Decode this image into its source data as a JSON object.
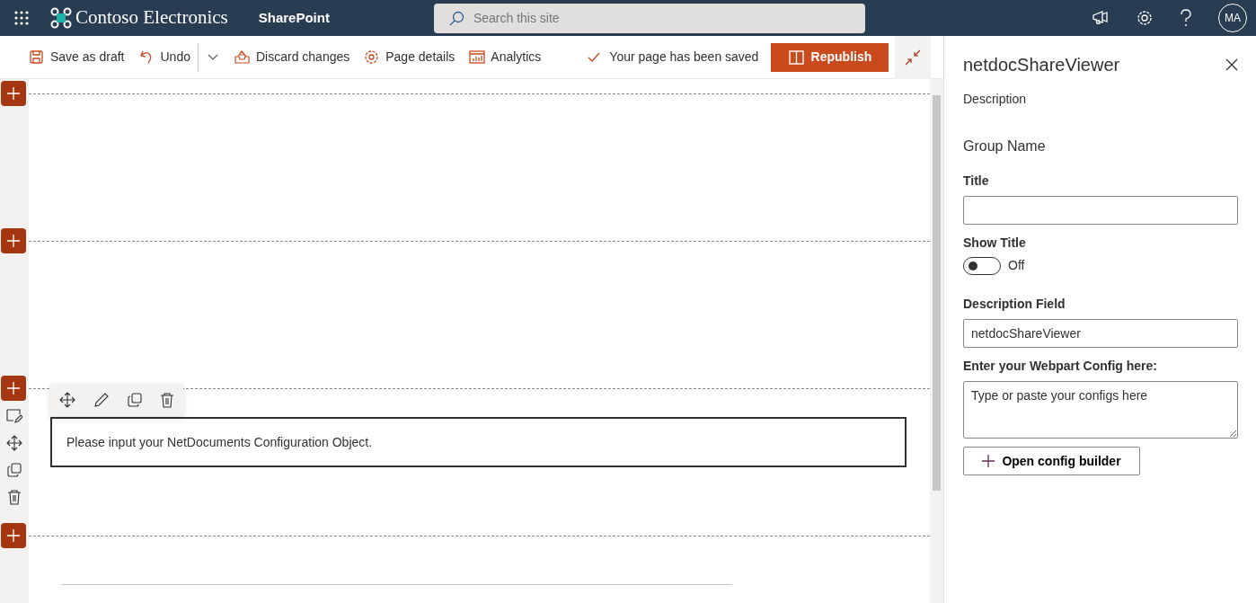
{
  "header": {
    "site_title": "Contoso Electronics",
    "app_name": "SharePoint",
    "search": {
      "placeholder": "Search this site"
    },
    "avatar": "MA"
  },
  "toolbar": {
    "items": [
      {
        "kind": "save",
        "label": "Save as draft"
      },
      {
        "kind": "undo",
        "label": "Undo"
      },
      {
        "kind": "dropdown"
      },
      {
        "kind": "discard",
        "label": "Discard changes"
      },
      {
        "kind": "details",
        "label": "Page details"
      },
      {
        "kind": "analytics",
        "label": "Analytics"
      }
    ],
    "status": "Your page has been saved",
    "publish": "Republish"
  },
  "canvas": {
    "sections": [
      {
        "kind": "empty"
      },
      {
        "kind": "empty"
      },
      {
        "kind": "webpart",
        "selected": true,
        "text": "Please input your NetDocuments Configuration Object."
      },
      {
        "kind": "empty"
      }
    ]
  },
  "panel": {
    "title": "netdocShareViewer",
    "description": "Description",
    "group": "Group Name",
    "fields": [
      {
        "kind": "text",
        "label": "Title"
      },
      {
        "kind": "toggle",
        "label": "Show Title",
        "on": false,
        "state_text": "Off"
      },
      {
        "kind": "text",
        "label": "Description Field",
        "value": "netdocShareViewer"
      },
      {
        "kind": "textarea",
        "label": "Enter your Webpart Config here:",
        "placeholder": "Type or paste your configs here"
      }
    ],
    "button": "Open config builder"
  }
}
